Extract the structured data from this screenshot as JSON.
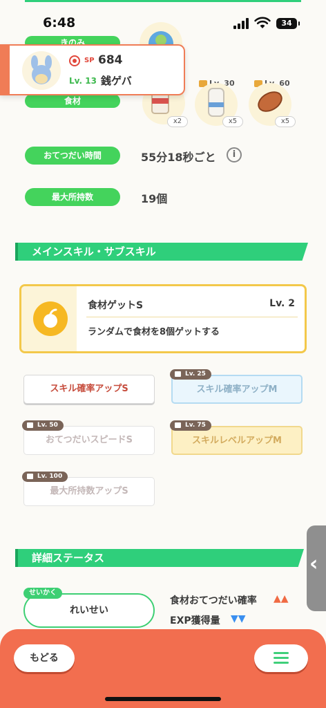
{
  "status": {
    "time": "6:48",
    "battery": "34"
  },
  "rows": {
    "nomi_label": "きのみ",
    "ingredients_label": "食材",
    "help_time_label": "おてつだい時間",
    "help_time_value": "55分18秒ごと",
    "max_carry_label": "最大所持数",
    "max_carry_value": "19個"
  },
  "ingredients": [
    {
      "qty": "x2"
    },
    {
      "lock_level": "Lv. 30",
      "qty": "x5"
    },
    {
      "lock_level": "Lv. 60",
      "qty": "x5"
    }
  ],
  "pokemon": {
    "sp_label": "SP",
    "sp_value": "684",
    "level": "Lv. 13",
    "name": "銭ゲバ"
  },
  "main_sub_section": "メインスキル・サブスキル",
  "main_skill": {
    "name": "食材ゲットS",
    "level": "Lv. 2",
    "desc": "ランダムで食材を8個ゲットする"
  },
  "sub_skills": [
    {
      "label": "スキル確率アップS",
      "unlock": ""
    },
    {
      "label": "スキル確率アップM",
      "unlock": "Lv. 25"
    },
    {
      "label": "おてつだいスピードS",
      "unlock": "Lv. 50"
    },
    {
      "label": "スキルレベルアップM",
      "unlock": "Lv. 75"
    },
    {
      "label": "最大所持数アップS",
      "unlock": "Lv. 100"
    }
  ],
  "detail_section": "詳細ステータス",
  "nature": {
    "tag": "せいかく",
    "value": "れいせい"
  },
  "stats": [
    {
      "label": "食材おてつだい確率",
      "arrows": "▲▲",
      "color": "#f06a43"
    },
    {
      "label": "EXP獲得量",
      "arrows": "▼▼",
      "color": "#3a8ff0"
    }
  ],
  "nav": {
    "back": "もどる"
  },
  "colors": {
    "accent_green": "#2fcf7b",
    "accent_orange": "#f26e4f",
    "skill_gold": "#f3c84a"
  }
}
